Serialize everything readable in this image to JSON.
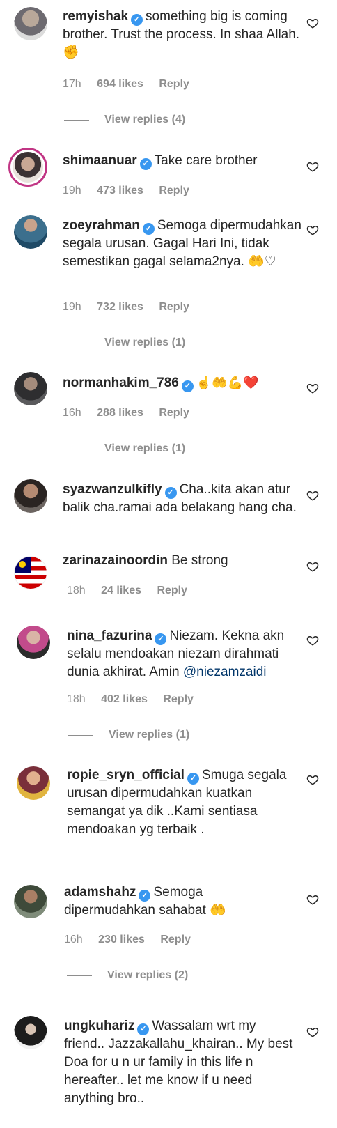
{
  "comments": [
    {
      "username": "remyishak",
      "verified": true,
      "text": "something big is coming brother. Trust the process. In shaa Allah. ✊",
      "time": "17h",
      "likes": "694 likes",
      "reply": "Reply",
      "view_replies": "View replies (4)"
    },
    {
      "username": "shimaanuar",
      "verified": true,
      "text": "Take care brother",
      "time": "19h",
      "likes": "473 likes",
      "reply": "Reply"
    },
    {
      "username": "zoeyrahman",
      "verified": true,
      "text": "Semoga dipermudahkan segala urusan. Gagal Hari Ini, tidak semestikan gagal selama2nya. 🤲♡",
      "time": "19h",
      "likes": "732 likes",
      "reply": "Reply",
      "view_replies": "View replies (1)"
    },
    {
      "username": "normanhakim_786",
      "verified": true,
      "text": "☝🤲💪❤️",
      "time": "16h",
      "likes": "288 likes",
      "reply": "Reply",
      "view_replies": "View replies (1)"
    },
    {
      "username": "syazwanzulkifly",
      "verified": true,
      "text": "Cha..kita akan atur balik cha.ramai ada belakang hang cha."
    },
    {
      "username": "zarinazainoordin",
      "verified": false,
      "text": "Be strong",
      "time": "18h",
      "likes": "24 likes",
      "reply": "Reply"
    },
    {
      "username": "nina_fazurina",
      "verified": true,
      "text": "Niezam. Kekna akn selalu mendoakan niezam dirahmati dunia akhirat. Amin ",
      "mention": "@niezamzaidi",
      "time": "18h",
      "likes": "402 likes",
      "reply": "Reply",
      "view_replies": "View replies (1)"
    },
    {
      "username": "ropie_sryn_official",
      "verified": true,
      "text": "Smuga segala urusan dipermudahkan kuatkan semangat ya dik ..Kami sentiasa mendoakan yg terbaik ."
    },
    {
      "username": "adamshahz",
      "verified": true,
      "text": "Semoga dipermudahkan sahabat 🤲",
      "time": "16h",
      "likes": "230 likes",
      "reply": "Reply",
      "view_replies": "View replies (2)"
    },
    {
      "username": "ungkuhariz",
      "verified": true,
      "text": "Wassalam wrt my friend.. Jazzakallahu_khairan.. My best Doa for u n ur family in this life n hereafter.. let me know if u need anything bro.."
    }
  ],
  "colors": {
    "username": "#262626",
    "meta": "#8e8e8e",
    "verified": "#3897f0",
    "mention": "#003569",
    "story_ring": "#c13584"
  }
}
